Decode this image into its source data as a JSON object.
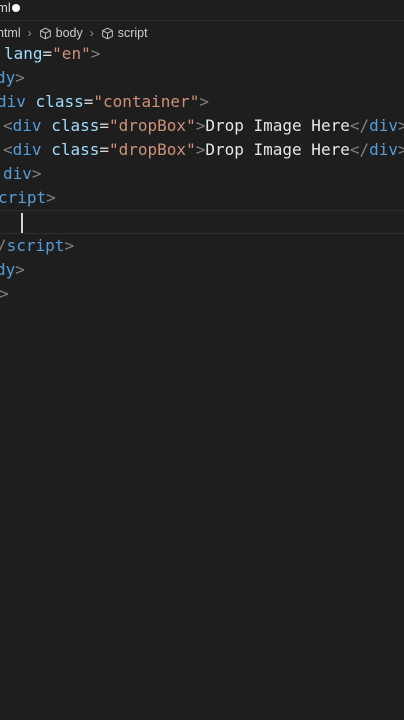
{
  "tab": {
    "title": "ml"
  },
  "breadcrumb": {
    "items": [
      {
        "label": "html",
        "icon": "cube-icon"
      },
      {
        "label": "body",
        "icon": "cube-icon"
      },
      {
        "label": "script",
        "icon": "cube-icon"
      }
    ],
    "separator": "›"
  },
  "code": {
    "lines": [
      {
        "t1": "lang",
        "t2": "=",
        "t3": "\"en\"",
        "t4": ">"
      },
      {
        "t1": "dy",
        "t2": ">"
      },
      {
        "t1": "div",
        "t2": "class",
        "t3": "=",
        "t4": "\"container\"",
        "t5": ">"
      },
      {
        "t1": "<",
        "t2": "div",
        "t3": "class",
        "t4": "=",
        "t5": "\"dropBox\"",
        "t6": ">",
        "t7": "Drop Image Here",
        "t8": "</",
        "t9": "div",
        "t10": ">"
      },
      {
        "t1": "<",
        "t2": "div",
        "t3": "class",
        "t4": "=",
        "t5": "\"dropBox\"",
        "t6": ">",
        "t7": "Drop Image Here",
        "t8": "</",
        "t9": "div",
        "t10": ">"
      },
      {
        "t1": "div",
        "t2": ">"
      },
      {
        "t1": "cript",
        "t2": ">"
      },
      {},
      {
        "t1": "/",
        "t2": "script",
        "t3": ">"
      },
      {
        "t1": "dy",
        "t2": ">"
      },
      {
        "t1": ">"
      }
    ]
  },
  "colors": {
    "background": "#1e1e1e",
    "tag": "#569cd6",
    "bracket": "#808080",
    "attribute": "#9cdcfe",
    "string": "#ce9178",
    "text": "#e6e6e6"
  }
}
